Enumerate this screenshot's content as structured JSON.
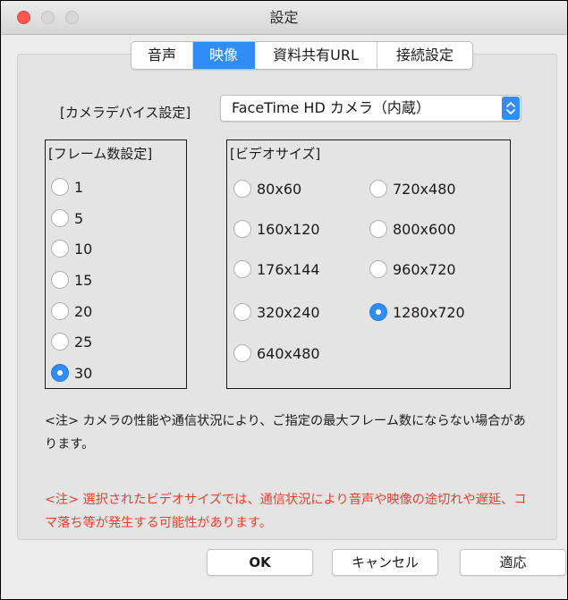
{
  "window": {
    "title": "設定"
  },
  "tabs": [
    {
      "label": "音声",
      "active": false
    },
    {
      "label": "映像",
      "active": true
    },
    {
      "label": "資料共有URL",
      "active": false
    },
    {
      "label": "接続設定",
      "active": false
    }
  ],
  "camera": {
    "label": "[カメラデバイス設定]",
    "selected": "FaceTime HD カメラ（内蔵）"
  },
  "frame_rate": {
    "title": "[フレーム数設定]",
    "options": [
      "1",
      "5",
      "10",
      "15",
      "20",
      "25",
      "30"
    ],
    "selected": "30"
  },
  "video_size": {
    "title": "[ビデオサイズ]",
    "options_left": [
      "80x60",
      "160x120",
      "176x144",
      "320x240",
      "640x480"
    ],
    "options_right": [
      "720x480",
      "800x600",
      "960x720",
      "1280x720"
    ],
    "selected": "1280x720"
  },
  "notes": {
    "note1": "<注> カメラの性能や通信状況により、ご指定の最大フレーム数にならない場合があります。",
    "note2": "<注> 選択されたビデオサイズでは、通信状況により音声や映像の途切れや遅延、コマ落ち等が発生する可能性があります。",
    "note2_color": "#e8402f"
  },
  "buttons": {
    "ok": "OK",
    "cancel": "キャンセル",
    "apply": "適応"
  },
  "colors": {
    "accent": "#2f8df5",
    "close": "#fc5753"
  }
}
